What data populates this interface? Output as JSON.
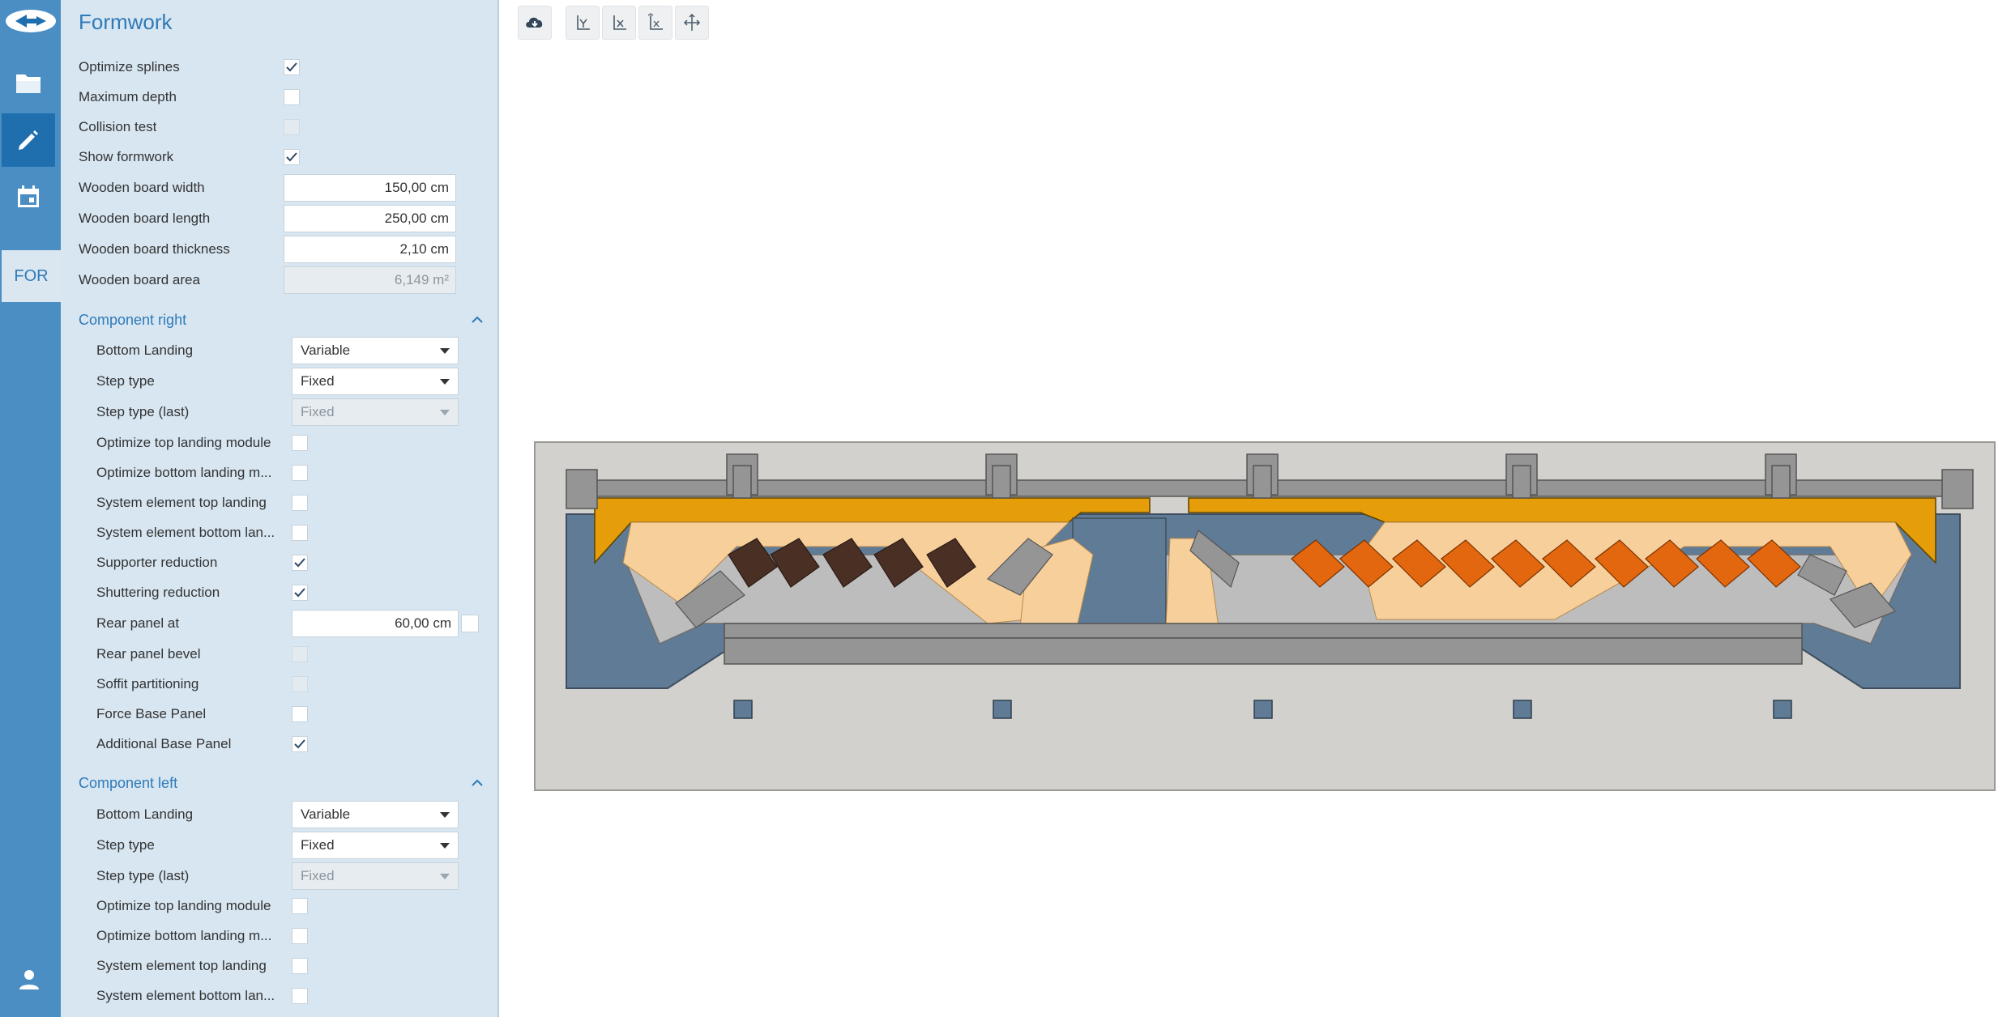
{
  "app": {
    "sidebar": {
      "items": [
        {
          "icon": "app-logo-icon"
        },
        {
          "icon": "folder-icon"
        },
        {
          "icon": "pencil-icon"
        },
        {
          "icon": "calendar-icon"
        },
        {
          "label": "FOR"
        },
        {
          "icon": "user-icon"
        }
      ]
    }
  },
  "panel": {
    "title": "Formwork",
    "general": [
      {
        "label": "Optimize splines",
        "checked": true
      },
      {
        "label": "Maximum depth",
        "checked": false
      },
      {
        "label": "Collision test",
        "checked": false,
        "disabled": true
      },
      {
        "label": "Show formwork",
        "checked": true
      }
    ],
    "fields": [
      {
        "label": "Wooden board width",
        "value": "150,00 cm"
      },
      {
        "label": "Wooden board length",
        "value": "250,00 cm"
      },
      {
        "label": "Wooden board thickness",
        "value": "2,10 cm"
      },
      {
        "label": "Wooden board area",
        "value": "6,149 m²",
        "disabled": true
      }
    ],
    "component_right": {
      "title": "Component right",
      "bottom_landing": {
        "label": "Bottom Landing",
        "value": "Variable"
      },
      "step_type": {
        "label": "Step type",
        "value": "Fixed"
      },
      "step_type_last": {
        "label": "Step type (last)",
        "value": "Fixed"
      },
      "checks": [
        {
          "label": "Optimize top landing module",
          "checked": false
        },
        {
          "label": "Optimize bottom landing m...",
          "checked": false
        },
        {
          "label": "System element top landing",
          "checked": false
        },
        {
          "label": "System element bottom lan...",
          "checked": false
        },
        {
          "label": "Supporter reduction",
          "checked": true
        },
        {
          "label": "Shuttering reduction",
          "checked": true
        }
      ],
      "rear_panel": {
        "label": "Rear panel at",
        "value": "60,00 cm"
      },
      "checks2": [
        {
          "label": "Rear panel bevel",
          "checked": false,
          "disabled": true
        },
        {
          "label": "Soffit partitioning",
          "checked": false,
          "disabled": true
        },
        {
          "label": "Force Base Panel",
          "checked": false
        },
        {
          "label": "Additional Base Panel",
          "checked": true
        }
      ]
    },
    "component_left": {
      "title": "Component left",
      "bottom_landing": {
        "label": "Bottom Landing",
        "value": "Variable"
      },
      "step_type": {
        "label": "Step type",
        "value": "Fixed"
      },
      "step_type_last": {
        "label": "Step type (last)",
        "value": "Fixed"
      },
      "checks": [
        {
          "label": "Optimize top landing module",
          "checked": false
        },
        {
          "label": "Optimize bottom landing m...",
          "checked": false
        },
        {
          "label": "System element top landing",
          "checked": false
        },
        {
          "label": "System element bottom lan...",
          "checked": false
        }
      ]
    }
  },
  "toolbar": {
    "buttons": [
      {
        "icon": "cloud-download-icon"
      },
      {
        "icon": "axis-y-icon"
      },
      {
        "icon": "axis-x-icon"
      },
      {
        "icon": "axis-xy-icon"
      },
      {
        "icon": "move-arrows-icon"
      }
    ]
  },
  "colors": {
    "rail": "#4a8ec4",
    "panel": "#d7e6f1",
    "accent": "#2f7ab8",
    "drawing_bg": "#d3d1cd",
    "steel_blue": "#5f7b96",
    "gold": "#e59d0a",
    "light_wood": "#f7cf9a",
    "dark_brown": "#4a2f25",
    "orange": "#e2670f",
    "gray": "#959595"
  }
}
